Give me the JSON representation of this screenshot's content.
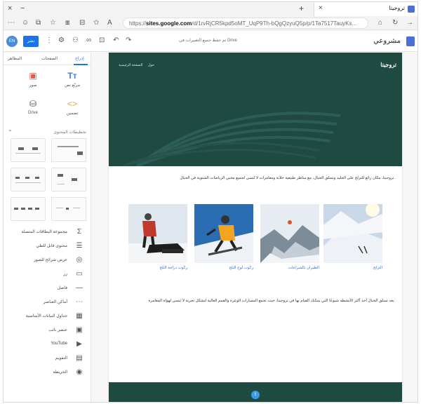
{
  "browser": {
    "tab_title": "تروجيتا",
    "url_host": "sites.google.com",
    "url_prefix": "https://",
    "url_rest": "/d/1rvRjCR5kpd5oMT_UqP9Th-bQgQzyuQ5p/p/1Ta7517TauyKs...",
    "controls": {
      "close": "×",
      "minimize": "−",
      "tab_close": "×",
      "new_tab": "+"
    }
  },
  "toolbar": {
    "avatar_text": "EN",
    "publish_label": "نشر",
    "draft_message": "تم حفظ جميع التغييرات في Drive",
    "site_title": "مشروعي"
  },
  "panel": {
    "tabs": {
      "insert": "إدراج",
      "pages": "الصفحات",
      "themes": "المظاهر"
    },
    "insert_items": {
      "textbox": "مربّع نص",
      "images": "صور",
      "embed": "تضمين",
      "drive": "Drive"
    },
    "layouts_header": "تخطيطات المحتوى",
    "blocks": [
      {
        "label": "مجموعة البطاقات المتصلة",
        "icon": "Σ"
      },
      {
        "label": "محتوى قابل للطي",
        "icon": "☰"
      },
      {
        "label": "عرض شرائح للصور",
        "icon": "◎"
      },
      {
        "label": "زر",
        "icon": "▭"
      },
      {
        "label": "فاصل",
        "icon": "—"
      },
      {
        "label": "أماكن العناصر",
        "icon": "⋯"
      },
      {
        "label": "جداول البيانات الأساسية",
        "icon": "▦"
      },
      {
        "label": "عنصر نائب",
        "icon": "▣"
      },
      {
        "label": "YouTube",
        "icon": "▶"
      },
      {
        "label": "التقويم",
        "icon": "▤"
      },
      {
        "label": "الخريطة",
        "icon": "◉"
      }
    ]
  },
  "site": {
    "name": "تروجيتا",
    "nav": [
      "حول",
      "الصفحة الرئيسية"
    ],
    "intro": "تروجيتا، مكان رائع للتزلج على الجليد وتسلق الجبال، مع مناظر طبيعية خلابة ومغامرات لا تُنسى لجميع محبي الرياضات الشتوية في الجبال.",
    "gallery": [
      {
        "caption": "التزلج"
      },
      {
        "caption": "الطيران بالشراعات"
      },
      {
        "caption": "ركوب لوح الثلج"
      },
      {
        "caption": "ركوب دراجة الثلج"
      }
    ],
    "para2": "بعد تسلق الجبال أحد أكثر الأنشطة شيوعًا التي يمكنك القيام بها في تروجيتا، حيث تجمع المسارات الوعرة والقمم العالية لتشكل تجربة لا تنسى لهواة المغامرة."
  },
  "colors": {
    "accent": "#1a73e8",
    "hero": "#1f4a42",
    "link": "#3a6fc4"
  }
}
